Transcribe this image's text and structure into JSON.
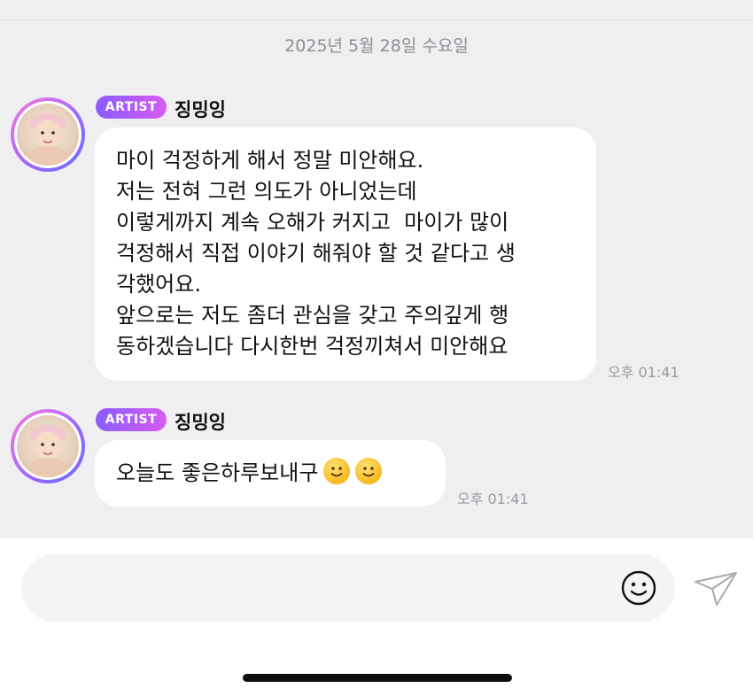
{
  "date_separator": "2025년 5월 28일 수요일",
  "messages": [
    {
      "badge": "ARTIST",
      "sender": "징밍잉",
      "lines": [
        "마이 걱정하게 해서 정말 미안해요.",
        "저는 전혀 그런 의도가 아니었는데",
        "이렇게까지 계속 오해가 커지고  마이가 많이",
        "걱정해서 직접 이야기 해줘야 할 것 같다고 생",
        "각했어요.",
        "앞으로는 저도 좀더 관심을 갖고 주의깊게 행",
        "동하겠습니다 다시한번 걱정끼쳐서 미안해요"
      ],
      "time": "오후 01:41"
    },
    {
      "badge": "ARTIST",
      "sender": "징밍잉",
      "text": "오늘도 좋은하루보내구",
      "emojis": [
        "slightly-smiling-face",
        "slightly-smiling-face"
      ],
      "time": "오후 01:41"
    }
  ],
  "input": {
    "placeholder": "",
    "emoji_icon": "smiley-icon",
    "send_icon": "paper-plane-icon"
  },
  "colors": {
    "chat_background": "#efeff1",
    "badge_gradient_start": "#8a5cff",
    "badge_gradient_end": "#d75cf0",
    "bubble": "#ffffff"
  }
}
